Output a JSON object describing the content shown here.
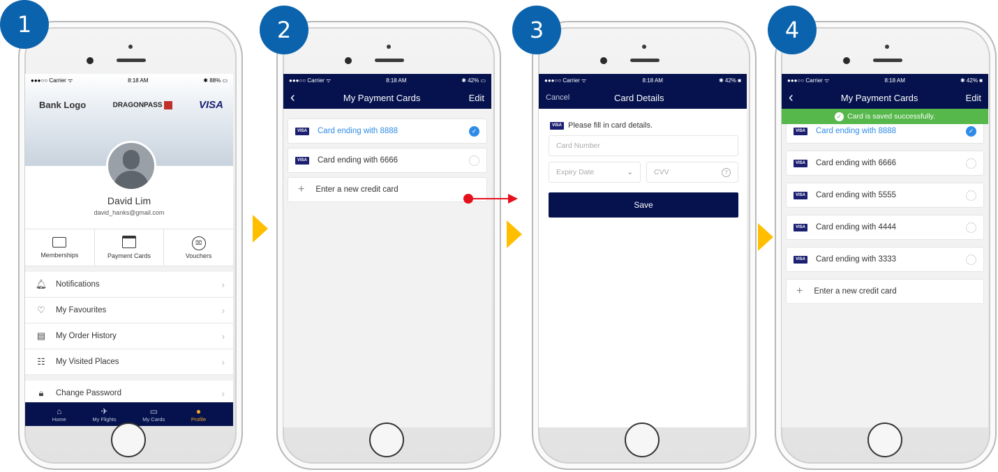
{
  "steps": [
    "1",
    "2",
    "3",
    "4"
  ],
  "colors": {
    "brand_navy": "#05124e",
    "badge_blue": "#0b63ad",
    "accent_blue": "#2f8ce6",
    "success_green": "#56b84b",
    "arrow_yellow": "#ffbf00",
    "tab_active": "#f5a623"
  },
  "screen1": {
    "status": {
      "carrier": "●●●○○ Carrier ᯤ",
      "time": "8:18 AM",
      "battery": "✱ 88% ▭"
    },
    "banner": {
      "bank_logo": "Bank Logo",
      "dragonpass": "DRAGONPASS",
      "visa": "VISA"
    },
    "user": {
      "name": "David Lim",
      "email": "david_hanks@gmail.com"
    },
    "quick": [
      {
        "label": "Memberships",
        "icon": "membership-card-icon"
      },
      {
        "label": "Payment Cards",
        "icon": "credit-card-icon"
      },
      {
        "label": "Vouchers",
        "icon": "voucher-icon"
      }
    ],
    "menu": [
      {
        "label": "Notifications",
        "icon": "bell-icon"
      },
      {
        "label": "My Favourites",
        "icon": "heart-icon"
      },
      {
        "label": "My Order History",
        "icon": "clipboard-icon"
      },
      {
        "label": "My Visited Places",
        "icon": "location-list-icon"
      }
    ],
    "menu2": {
      "label": "Change Password",
      "icon": "lock-icon"
    },
    "tabs": [
      {
        "label": "Home",
        "icon": "home-icon"
      },
      {
        "label": "My Flights",
        "icon": "plane-icon"
      },
      {
        "label": "My Cards",
        "icon": "card-icon"
      },
      {
        "label": "Profile",
        "icon": "profile-icon"
      }
    ]
  },
  "screen2": {
    "status": {
      "carrier": "●●●○○ Carrier ᯤ",
      "time": "8:18 AM",
      "battery": "✱ 42% ▭"
    },
    "nav": {
      "title": "My Payment Cards",
      "right": "Edit"
    },
    "cards": [
      "Card ending with 8888",
      "Card ending with 6666"
    ],
    "add": "Enter a new credit card"
  },
  "screen3": {
    "status": {
      "carrier": "●●●○○ Carrier ᯤ",
      "time": "8:18 AM",
      "battery": "✱ 42% ■"
    },
    "nav": {
      "left": "Cancel",
      "title": "Card Details"
    },
    "hint": "Please fill in card details.",
    "card_number_placeholder": "Card Number",
    "expiry_placeholder": "Expiry Date",
    "cvv_placeholder": "CVV",
    "save": "Save"
  },
  "screen4": {
    "status": {
      "carrier": "●●●○○ Carrier ᯤ",
      "time": "8:18 AM",
      "battery": "✱ 42% ■"
    },
    "nav": {
      "title": "My Payment Cards",
      "right": "Edit"
    },
    "toast": "Card is saved successfully.",
    "cards": [
      "Card ending with 8888",
      "Card ending with 6666",
      "Card ending with 5555",
      "Card ending with 4444",
      "Card ending with 3333"
    ],
    "add": "Enter a new credit card"
  },
  "visa_mark": "VISA"
}
